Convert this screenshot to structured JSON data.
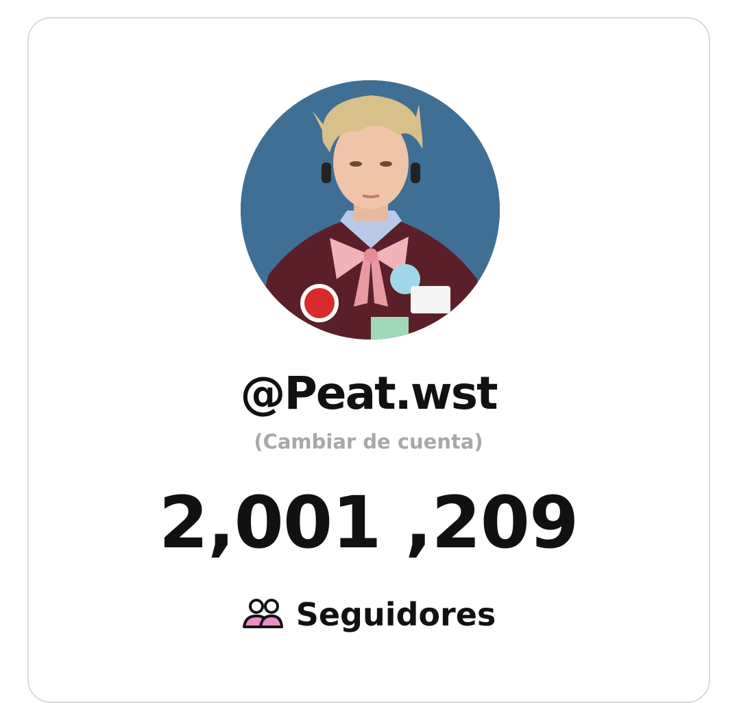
{
  "profile": {
    "username": "@Peat.wst",
    "switch_account": "(Cambiar de cuenta)",
    "avatar": "profile-photo"
  },
  "stats": {
    "followers_count": "2,001 ,209",
    "followers_label": "Seguidores",
    "followers_icon": "users-icon"
  },
  "colors": {
    "text": "#111111",
    "muted": "#a8a8a8",
    "border": "#d9d9d9",
    "avatar_bg": "#3f6f95",
    "icon_accent": "#f08cc5"
  }
}
